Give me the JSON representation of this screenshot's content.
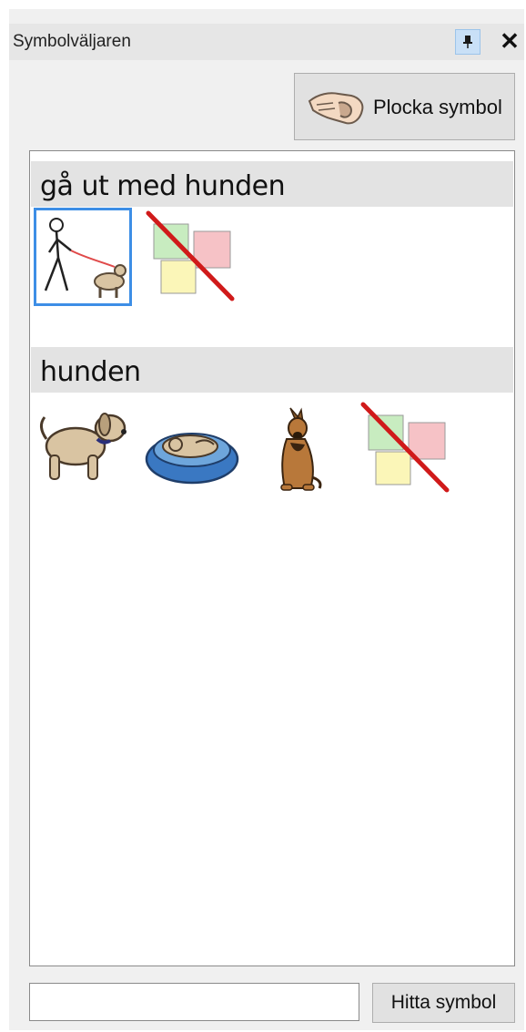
{
  "panel": {
    "title": "Symbolväljaren",
    "pin_icon": "pin-icon",
    "close_label": "✕"
  },
  "toolbar": {
    "pick_label": "Plocka symbol",
    "pick_icon": "hand-icon"
  },
  "groups": [
    {
      "label": "gå ut med hunden",
      "symbols": [
        {
          "icon": "person-walking-dog-icon",
          "selected": true
        },
        {
          "icon": "no-symbol-icon",
          "selected": false
        }
      ]
    },
    {
      "label": "hunden",
      "symbols": [
        {
          "icon": "dog-icon",
          "selected": false
        },
        {
          "icon": "dog-in-basket-icon",
          "selected": false
        },
        {
          "icon": "german-shepherd-icon",
          "selected": false
        },
        {
          "icon": "no-symbol-icon",
          "selected": false
        }
      ]
    }
  ],
  "search": {
    "value": "",
    "placeholder": "",
    "button_label": "Hitta symbol"
  },
  "colors": {
    "selection": "#3d8ee6",
    "header_bg": "#e3e3e3",
    "pin_bg": "#c9e0f7"
  }
}
